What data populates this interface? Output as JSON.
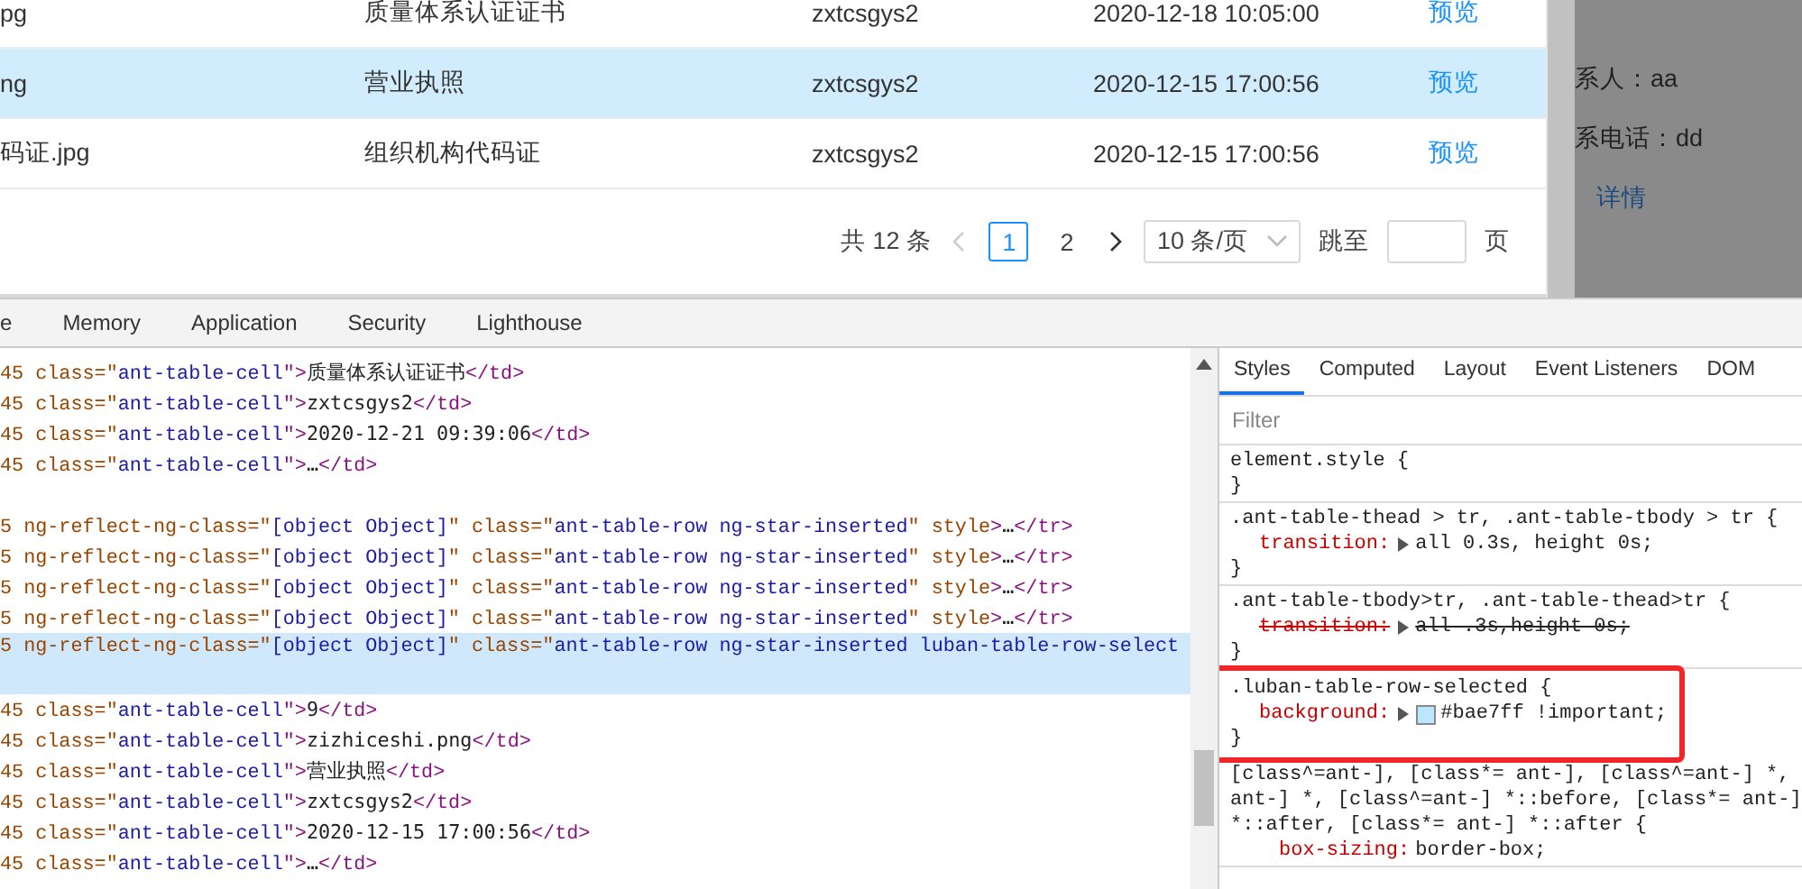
{
  "table": {
    "rows": [
      {
        "cells": [
          "pg",
          "质量体系认证证书",
          "zxtcsgys2",
          "2020-12-18 10:05:00"
        ],
        "action": "预览",
        "selected": false
      },
      {
        "cells": [
          "ng",
          "营业执照",
          "zxtcsgys2",
          "2020-12-15 17:00:56"
        ],
        "action": "预览",
        "selected": true
      },
      {
        "cells": [
          "码证.jpg",
          "组织机构代码证",
          "zxtcsgys2",
          "2020-12-15 17:00:56"
        ],
        "action": "预览",
        "selected": false
      }
    ]
  },
  "pagination": {
    "total": "共 12 条",
    "prev_disabled": true,
    "next_disabled": false,
    "pages": [
      {
        "label": "1",
        "selected": true
      },
      {
        "label": "2",
        "selected": false
      }
    ],
    "page_size": "10 条/页",
    "jump_label": "跳至",
    "page_unit": "页"
  },
  "side_panel": {
    "fields": [
      {
        "label": "系人：",
        "value": "aa"
      },
      {
        "label": "系电话：",
        "value": "dd"
      }
    ],
    "link": "详情"
  },
  "devtools": {
    "tabs": [
      {
        "label": "e",
        "selected": false
      },
      {
        "label": "Memory",
        "selected": false
      },
      {
        "label": "Application",
        "selected": false
      },
      {
        "label": "Security",
        "selected": false
      },
      {
        "label": "Lighthouse",
        "selected": false
      }
    ],
    "elements": {
      "lines": [
        {
          "kind": "code",
          "selected": false,
          "segments": [
            {
              "kind": "attr",
              "text": "45 class=\""
            },
            {
              "kind": "value",
              "text": "ant-table-cell"
            },
            {
              "kind": "tag",
              "text": "\">"
            },
            {
              "kind": "text",
              "text": "质量体系认证证书"
            },
            {
              "kind": "tag",
              "text": "</td>"
            }
          ]
        },
        {
          "kind": "code",
          "selected": false,
          "segments": [
            {
              "kind": "attr",
              "text": "45 class=\""
            },
            {
              "kind": "value",
              "text": "ant-table-cell"
            },
            {
              "kind": "tag",
              "text": "\">"
            },
            {
              "kind": "text",
              "text": "zxtcsgys2"
            },
            {
              "kind": "tag",
              "text": "</td>"
            }
          ]
        },
        {
          "kind": "code",
          "selected": false,
          "segments": [
            {
              "kind": "attr",
              "text": "45 class=\""
            },
            {
              "kind": "value",
              "text": "ant-table-cell"
            },
            {
              "kind": "tag",
              "text": "\">"
            },
            {
              "kind": "text",
              "text": "2020-12-21 09:39:06"
            },
            {
              "kind": "tag",
              "text": "</td>"
            }
          ]
        },
        {
          "kind": "code",
          "selected": false,
          "segments": [
            {
              "kind": "attr",
              "text": "45 class=\""
            },
            {
              "kind": "value",
              "text": "ant-table-cell"
            },
            {
              "kind": "tag",
              "text": "\">"
            },
            {
              "kind": "text",
              "text": "…"
            },
            {
              "kind": "tag",
              "text": "</td>"
            }
          ]
        },
        {
          "kind": "blank"
        },
        {
          "kind": "code",
          "selected": false,
          "segments": [
            {
              "kind": "attr",
              "text": "5 ng-reflect-ng-class=\""
            },
            {
              "kind": "value",
              "text": "[object Object]"
            },
            {
              "kind": "attr",
              "text": "\" class=\""
            },
            {
              "kind": "value",
              "text": "ant-table-row ng-star-inserted"
            },
            {
              "kind": "attr",
              "text": "\" style"
            },
            {
              "kind": "tag",
              "text": ">"
            },
            {
              "kind": "text",
              "text": "…"
            },
            {
              "kind": "tag",
              "text": "</tr>"
            }
          ]
        },
        {
          "kind": "code",
          "selected": false,
          "segments": [
            {
              "kind": "attr",
              "text": "5 ng-reflect-ng-class=\""
            },
            {
              "kind": "value",
              "text": "[object Object]"
            },
            {
              "kind": "attr",
              "text": "\" class=\""
            },
            {
              "kind": "value",
              "text": "ant-table-row ng-star-inserted"
            },
            {
              "kind": "attr",
              "text": "\" style"
            },
            {
              "kind": "tag",
              "text": ">"
            },
            {
              "kind": "text",
              "text": "…"
            },
            {
              "kind": "tag",
              "text": "</tr>"
            }
          ]
        },
        {
          "kind": "code",
          "selected": false,
          "segments": [
            {
              "kind": "attr",
              "text": "5 ng-reflect-ng-class=\""
            },
            {
              "kind": "value",
              "text": "[object Object]"
            },
            {
              "kind": "attr",
              "text": "\" class=\""
            },
            {
              "kind": "value",
              "text": "ant-table-row ng-star-inserted"
            },
            {
              "kind": "attr",
              "text": "\" style"
            },
            {
              "kind": "tag",
              "text": ">"
            },
            {
              "kind": "text",
              "text": "…"
            },
            {
              "kind": "tag",
              "text": "</tr>"
            }
          ]
        },
        {
          "kind": "code",
          "selected": false,
          "segments": [
            {
              "kind": "attr",
              "text": "5 ng-reflect-ng-class=\""
            },
            {
              "kind": "value",
              "text": "[object Object]"
            },
            {
              "kind": "attr",
              "text": "\" class=\""
            },
            {
              "kind": "value",
              "text": "ant-table-row ng-star-inserted"
            },
            {
              "kind": "attr",
              "text": "\" style"
            },
            {
              "kind": "tag",
              "text": ">"
            },
            {
              "kind": "text",
              "text": "…"
            },
            {
              "kind": "tag",
              "text": "</tr>"
            }
          ]
        },
        {
          "kind": "code",
          "selected": true,
          "segments": [
            {
              "kind": "attr",
              "text": "5 ng-reflect-ng-class=\""
            },
            {
              "kind": "value",
              "text": "[object Object]"
            },
            {
              "kind": "attr",
              "text": "\" class=\""
            },
            {
              "kind": "value",
              "text": "ant-table-row ng-star-inserted luban-table-row-select"
            }
          ]
        },
        {
          "kind": "code",
          "selected": false,
          "segments": [
            {
              "kind": "attr",
              "text": "45 class=\""
            },
            {
              "kind": "value",
              "text": "ant-table-cell"
            },
            {
              "kind": "tag",
              "text": "\">"
            },
            {
              "kind": "text",
              "text": "9"
            },
            {
              "kind": "tag",
              "text": "</td>"
            }
          ]
        },
        {
          "kind": "code",
          "selected": false,
          "segments": [
            {
              "kind": "attr",
              "text": "45 class=\""
            },
            {
              "kind": "value",
              "text": "ant-table-cell"
            },
            {
              "kind": "tag",
              "text": "\">"
            },
            {
              "kind": "text",
              "text": "zizhiceshi.png"
            },
            {
              "kind": "tag",
              "text": "</td>"
            }
          ]
        },
        {
          "kind": "code",
          "selected": false,
          "segments": [
            {
              "kind": "attr",
              "text": "45 class=\""
            },
            {
              "kind": "value",
              "text": "ant-table-cell"
            },
            {
              "kind": "tag",
              "text": "\">"
            },
            {
              "kind": "text",
              "text": "营业执照"
            },
            {
              "kind": "tag",
              "text": "</td>"
            }
          ]
        },
        {
          "kind": "code",
          "selected": false,
          "segments": [
            {
              "kind": "attr",
              "text": "45 class=\""
            },
            {
              "kind": "value",
              "text": "ant-table-cell"
            },
            {
              "kind": "tag",
              "text": "\">"
            },
            {
              "kind": "text",
              "text": "zxtcsgys2"
            },
            {
              "kind": "tag",
              "text": "</td>"
            }
          ]
        },
        {
          "kind": "code",
          "selected": false,
          "segments": [
            {
              "kind": "attr",
              "text": "45 class=\""
            },
            {
              "kind": "value",
              "text": "ant-table-cell"
            },
            {
              "kind": "tag",
              "text": "\">"
            },
            {
              "kind": "text",
              "text": "2020-12-15 17:00:56"
            },
            {
              "kind": "tag",
              "text": "</td>"
            }
          ]
        },
        {
          "kind": "code",
          "selected": false,
          "segments": [
            {
              "kind": "attr",
              "text": "45 class=\""
            },
            {
              "kind": "value",
              "text": "ant-table-cell"
            },
            {
              "kind": "tag",
              "text": "\">"
            },
            {
              "kind": "text",
              "text": "…"
            },
            {
              "kind": "tag",
              "text": "</td>"
            }
          ]
        }
      ]
    },
    "styles": {
      "tabs": [
        {
          "label": "Styles",
          "selected": true
        },
        {
          "label": "Computed",
          "selected": false
        },
        {
          "label": "Layout",
          "selected": false
        },
        {
          "label": "Event Listeners",
          "selected": false
        },
        {
          "label": "DOM",
          "selected": false
        }
      ],
      "filter_placeholder": "Filter",
      "rules": [
        {
          "selector": [
            "element.style {"
          ],
          "close": "}",
          "highlighted": false
        },
        {
          "selector": [
            ".ant-table-thead > tr, .ant-table-tbody > tr {"
          ],
          "declarations": [
            {
              "name": "transition:",
              "value": "all 0.3s, height 0s;",
              "expandable": true,
              "overridden": false
            }
          ],
          "close": "}",
          "highlighted": false
        },
        {
          "selector": [
            ".ant-table-tbody>tr, .ant-table-thead>tr {"
          ],
          "declarations": [
            {
              "name": "transition:",
              "value": "all .3s,height 0s;",
              "expandable": true,
              "overridden": true
            }
          ],
          "close": "}",
          "highlighted": false
        },
        {
          "selector": [
            ".luban-table-row-selected {"
          ],
          "declarations": [
            {
              "name": "background:",
              "value": "#bae7ff !important;",
              "expandable": true,
              "overridden": false,
              "color": "#bae7ff"
            }
          ],
          "close": "}",
          "highlighted": true
        },
        {
          "selector": [
            "[class^=ant-], [class*= ant-], [class^=ant-] *,",
            "ant-] *, [class^=ant-] *::before, [class*= ant-]",
            "*::after, [class*= ant-] *::after {"
          ],
          "declarations": [
            {
              "name": "box-sizing:",
              "value": "border-box;",
              "expandable": false,
              "overridden": false
            }
          ],
          "highlighted": false
        }
      ]
    }
  }
}
